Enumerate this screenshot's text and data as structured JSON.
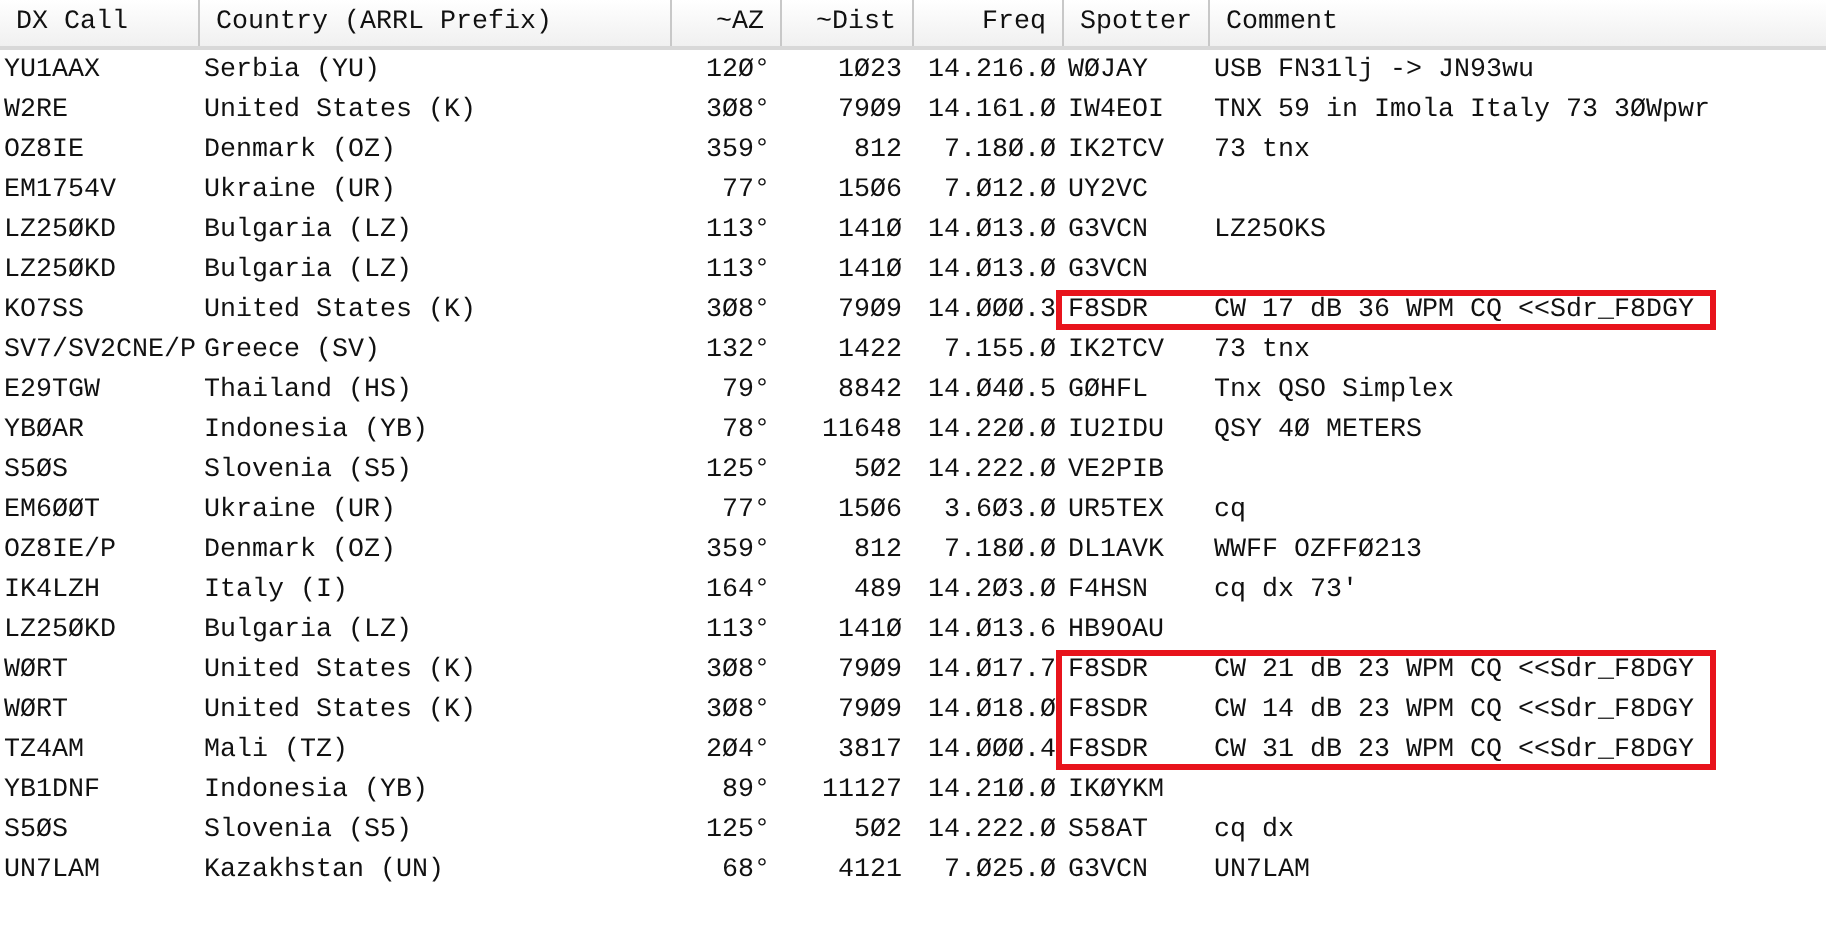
{
  "table": {
    "columns": [
      "DX Call",
      "Country (ARRL Prefix)",
      "~AZ",
      "~Dist",
      "Freq",
      "Spotter",
      "Comment"
    ],
    "rows": [
      {
        "call": "YU1AAX",
        "country": "Serbia (YU)",
        "az": "12Ø°",
        "dist": "1Ø23",
        "freq": "14.216.Ø",
        "spotter": "WØJAY",
        "comment": "USB FN31lj -> JN93wu",
        "highlighted": false
      },
      {
        "call": "W2RE",
        "country": "United States (K)",
        "az": "3Ø8°",
        "dist": "79Ø9",
        "freq": "14.161.Ø",
        "spotter": "IW4EOI",
        "comment": "TNX 59 in Imola Italy 73 3ØWpwr",
        "highlighted": false
      },
      {
        "call": "OZ8IE",
        "country": "Denmark (OZ)",
        "az": "359°",
        "dist": "812",
        "freq": "7.18Ø.Ø",
        "spotter": "IK2TCV",
        "comment": "73 tnx",
        "highlighted": false
      },
      {
        "call": "EM1754V",
        "country": "Ukraine (UR)",
        "az": "77°",
        "dist": "15Ø6",
        "freq": "7.Ø12.Ø",
        "spotter": "UY2VC",
        "highlighted": false
      },
      {
        "call": "LZ25ØKD",
        "country": "Bulgaria (LZ)",
        "az": "113°",
        "dist": "141Ø",
        "freq": "14.Ø13.Ø",
        "spotter": "G3VCN",
        "comment": "LZ25OKS",
        "highlighted": false
      },
      {
        "call": "LZ25ØKD",
        "country": "Bulgaria (LZ)",
        "az": "113°",
        "dist": "141Ø",
        "freq": "14.Ø13.Ø",
        "spotter": "G3VCN",
        "highlighted": false
      },
      {
        "call": "KO7SS",
        "country": "United States (K)",
        "az": "3Ø8°",
        "dist": "79Ø9",
        "freq": "14.ØØØ.3",
        "spotter": "F8SDR",
        "comment": "CW 17 dB 36 WPM CQ <<Sdr_F8DGY",
        "highlighted": true
      },
      {
        "call": "SV7/SV2CNE/P",
        "country": "Greece (SV)",
        "az": "132°",
        "dist": "1422",
        "freq": "7.155.Ø",
        "spotter": "IK2TCV",
        "comment": "73 tnx",
        "highlighted": false
      },
      {
        "call": "E29TGW",
        "country": "Thailand (HS)",
        "az": "79°",
        "dist": "8842",
        "freq": "14.Ø4Ø.5",
        "spotter": "GØHFL",
        "comment": "Tnx QSO Simplex",
        "highlighted": false
      },
      {
        "call": "YBØAR",
        "country": "Indonesia (YB)",
        "az": "78°",
        "dist": "11648",
        "freq": "14.22Ø.Ø",
        "spotter": "IU2IDU",
        "comment": "QSY 4Ø METERS",
        "highlighted": false
      },
      {
        "call": "S5ØS",
        "country": "Slovenia (S5)",
        "az": "125°",
        "dist": "5Ø2",
        "freq": "14.222.Ø",
        "spotter": "VE2PIB",
        "highlighted": false
      },
      {
        "call": "EM6ØØT",
        "country": "Ukraine (UR)",
        "az": "77°",
        "dist": "15Ø6",
        "freq": "3.6Ø3.Ø",
        "spotter": "UR5TEX",
        "comment": "cq",
        "highlighted": false
      },
      {
        "call": "OZ8IE/P",
        "country": "Denmark (OZ)",
        "az": "359°",
        "dist": "812",
        "freq": "7.18Ø.Ø",
        "spotter": "DL1AVK",
        "comment": "WWFF OZFFØ213",
        "highlighted": false
      },
      {
        "call": "IK4LZH",
        "country": "Italy (I)",
        "az": "164°",
        "dist": "489",
        "freq": "14.2Ø3.Ø",
        "spotter": "F4HSN",
        "comment": "cq dx 73'",
        "highlighted": false
      },
      {
        "call": "LZ25ØKD",
        "country": "Bulgaria (LZ)",
        "az": "113°",
        "dist": "141Ø",
        "freq": "14.Ø13.6",
        "spotter": "HB9OAU",
        "highlighted": false
      },
      {
        "call": "WØRT",
        "country": "United States (K)",
        "az": "3Ø8°",
        "dist": "79Ø9",
        "freq": "14.Ø17.7",
        "spotter": "F8SDR",
        "comment": "CW 21 dB 23 WPM CQ <<Sdr_F8DGY",
        "highlighted": true
      },
      {
        "call": "WØRT",
        "country": "United States (K)",
        "az": "3Ø8°",
        "dist": "79Ø9",
        "freq": "14.Ø18.Ø",
        "spotter": "F8SDR",
        "comment": "CW 14 dB 23 WPM CQ <<Sdr_F8DGY",
        "highlighted": true
      },
      {
        "call": "TZ4AM",
        "country": "Mali (TZ)",
        "az": "2Ø4°",
        "dist": "3817",
        "freq": "14.ØØØ.4",
        "spotter": "F8SDR",
        "comment": "CW 31 dB 23 WPM CQ <<Sdr_F8DGY",
        "highlighted": true
      },
      {
        "call": "YB1DNF",
        "country": "Indonesia (YB)",
        "az": "89°",
        "dist": "11127",
        "freq": "14.21Ø.Ø",
        "spotter": "IKØYKM",
        "highlighted": false
      },
      {
        "call": "S5ØS",
        "country": "Slovenia (S5)",
        "az": "125°",
        "dist": "5Ø2",
        "freq": "14.222.Ø",
        "spotter": "S58AT",
        "comment": "cq dx",
        "highlighted": false
      },
      {
        "call": "UN7LAM",
        "country": "Kazakhstan (UN)",
        "az": "68°",
        "dist": "4121",
        "freq": "7.Ø25.Ø",
        "spotter": "G3VCN",
        "comment": "UN7LAM",
        "highlighted": false
      }
    ]
  }
}
